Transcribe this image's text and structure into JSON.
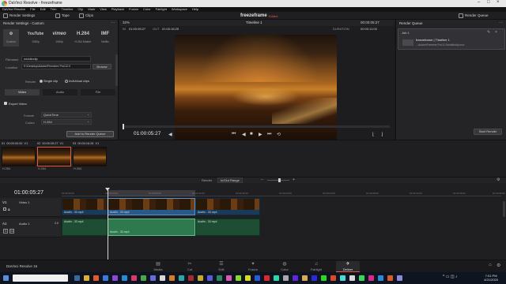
{
  "window": {
    "title": "DaVinci Resolve - freezeframe"
  },
  "menu": [
    "DaVinci Resolve",
    "File",
    "Edit",
    "Trim",
    "Timeline",
    "Clip",
    "Mark",
    "View",
    "Playback",
    "Fusion",
    "Color",
    "Fairlight",
    "Workspace",
    "Help"
  ],
  "toolbar": {
    "render_settings": "Render Settings",
    "tape": "Tape",
    "clips": "Clips",
    "project": "freezeframe",
    "edited": "Edited",
    "render_queue": "Render Queue"
  },
  "render_settings": {
    "title": "Render Settings - Custom",
    "presets": [
      {
        "logo": "Custom",
        "sub": "Custom"
      },
      {
        "logo": "YouTube",
        "sub": "1080p"
      },
      {
        "logo": "vimeo",
        "sub": "1080p"
      },
      {
        "logo": "H.264",
        "sub": "H.264 Master"
      },
      {
        "logo": "IMF",
        "sub": "Netflix"
      }
    ],
    "filename_label": "Filename",
    "filename_value": "middleclip",
    "location_label": "Location",
    "location_value": "E:\\Desktop\\Adobe\\Premiere Pro\\12.0",
    "browse": "Browse",
    "render_label": "Render",
    "single_clip": "Single clip",
    "individual_clips": "Individual clips",
    "tabs": [
      "Video",
      "Audio",
      "File"
    ],
    "export_video": "Export Video",
    "format_label": "Format",
    "format_value": "QuickTime",
    "codec_label": "Codec",
    "codec_value": "H.264",
    "add_button": "Add to Render Queue"
  },
  "viewer": {
    "zoom": "32%",
    "timeline_name": "Timeline 1",
    "header_tc": "00:00:05:27",
    "in_label": "IN",
    "in_tc": "01:00:05:27",
    "out_label": "OUT",
    "out_tc": "01:00:16:25",
    "duration_label": "DURATION",
    "duration_tc": "00:00:11:00",
    "current_tc": "01:00:05:27",
    "scrub_position": 0.0
  },
  "render_queue": {
    "title": "Render Queue",
    "job_label": "Job 1",
    "job_title": "freezeframe | Timeline 1",
    "job_path": "...\\Adobe\\Premiere Pro\\12.0\\middleclip.mov",
    "start_render": "Start Render"
  },
  "clips": [
    {
      "num": "01",
      "tc": "00:00:00:00",
      "v": "V1",
      "codec": "H.264"
    },
    {
      "num": "02",
      "tc": "00:00:05:27",
      "v": "V1",
      "codec": "H.264"
    },
    {
      "num": "03",
      "tc": "00:00:16:26",
      "v": "V1",
      "codec": "H.264"
    }
  ],
  "timeline": {
    "tc": "01:00:05:27",
    "render_label": "Render",
    "render_range": "In/Out Range",
    "ruler": [
      "01:00:00:00",
      "01:00:04:00",
      "01:00:08:00",
      "01:00:12:00",
      "01:00:16:00",
      "01:00:20:00",
      "01:00:24:00",
      "01:00:28:00",
      "01:00:32:00",
      "01:00:36:00",
      "01:00:40:00"
    ],
    "video_track": {
      "id": "V1",
      "name": "Video 1",
      "clips": [
        "Austin - 33.mp4",
        "Austin - 33.mp4",
        "Austin - 33.mp4"
      ]
    },
    "audio_track": {
      "id": "A1",
      "name": "Audio 1",
      "level": "2.0",
      "clips": [
        "Austin - 33.mp4",
        "Austin - 33.mp4",
        "Austin - 33.mp4"
      ]
    }
  },
  "pages": [
    "Media",
    "Cut",
    "Edit",
    "Fusion",
    "Color",
    "Fairlight",
    "Deliver"
  ],
  "active_page": "Deliver",
  "footer": {
    "app_name": "DaVinci Resolve 16"
  },
  "clock": {
    "time": "7:01 PM",
    "date": "4/21/2020"
  }
}
